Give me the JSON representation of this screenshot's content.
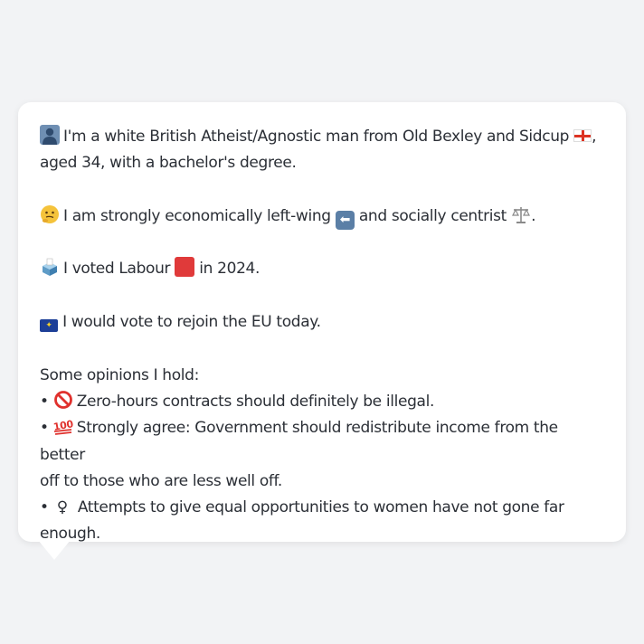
{
  "profile": {
    "intro_line1": "I'm a white British Atheist/Agnostic man from Old Bexley and Sidcup",
    "intro_line1_end": ",",
    "intro_line2": "aged 34, with a bachelor's degree.",
    "politics_a": "I am strongly economically left-wing",
    "politics_b": "and socially centrist",
    "politics_end": ".",
    "vote_a": "I voted Labour",
    "vote_b": "in 2024.",
    "eu": "I would vote to rejoin the EU today.",
    "opinions_heading": "Some opinions I hold:",
    "opinion1": "Zero-hours contracts should definitely be illegal.",
    "opinion2a": "Strongly agree: Government should redistribute income from the better",
    "opinion2b": "off to those who are less well off.",
    "opinion3a": "Attempts to give equal opportunities to women have not gone far",
    "opinion3b": "enough.",
    "bullet": "•"
  },
  "icons": {
    "person": "bust-in-silhouette-icon",
    "england_flag": "england-flag-icon",
    "thinking": "thinking-face-icon",
    "left_arrow": "left-arrow-icon",
    "scales": "balance-scale-icon",
    "ballot": "ballot-box-icon",
    "red_square": "red-square-icon",
    "eu_flag": "eu-flag-icon",
    "prohibited": "prohibited-icon",
    "hundred": "hundred-points-icon",
    "female": "female-sign-icon"
  },
  "colors": {
    "background": "#f2f3f5",
    "bubble": "#ffffff",
    "text": "#2b2f36"
  }
}
